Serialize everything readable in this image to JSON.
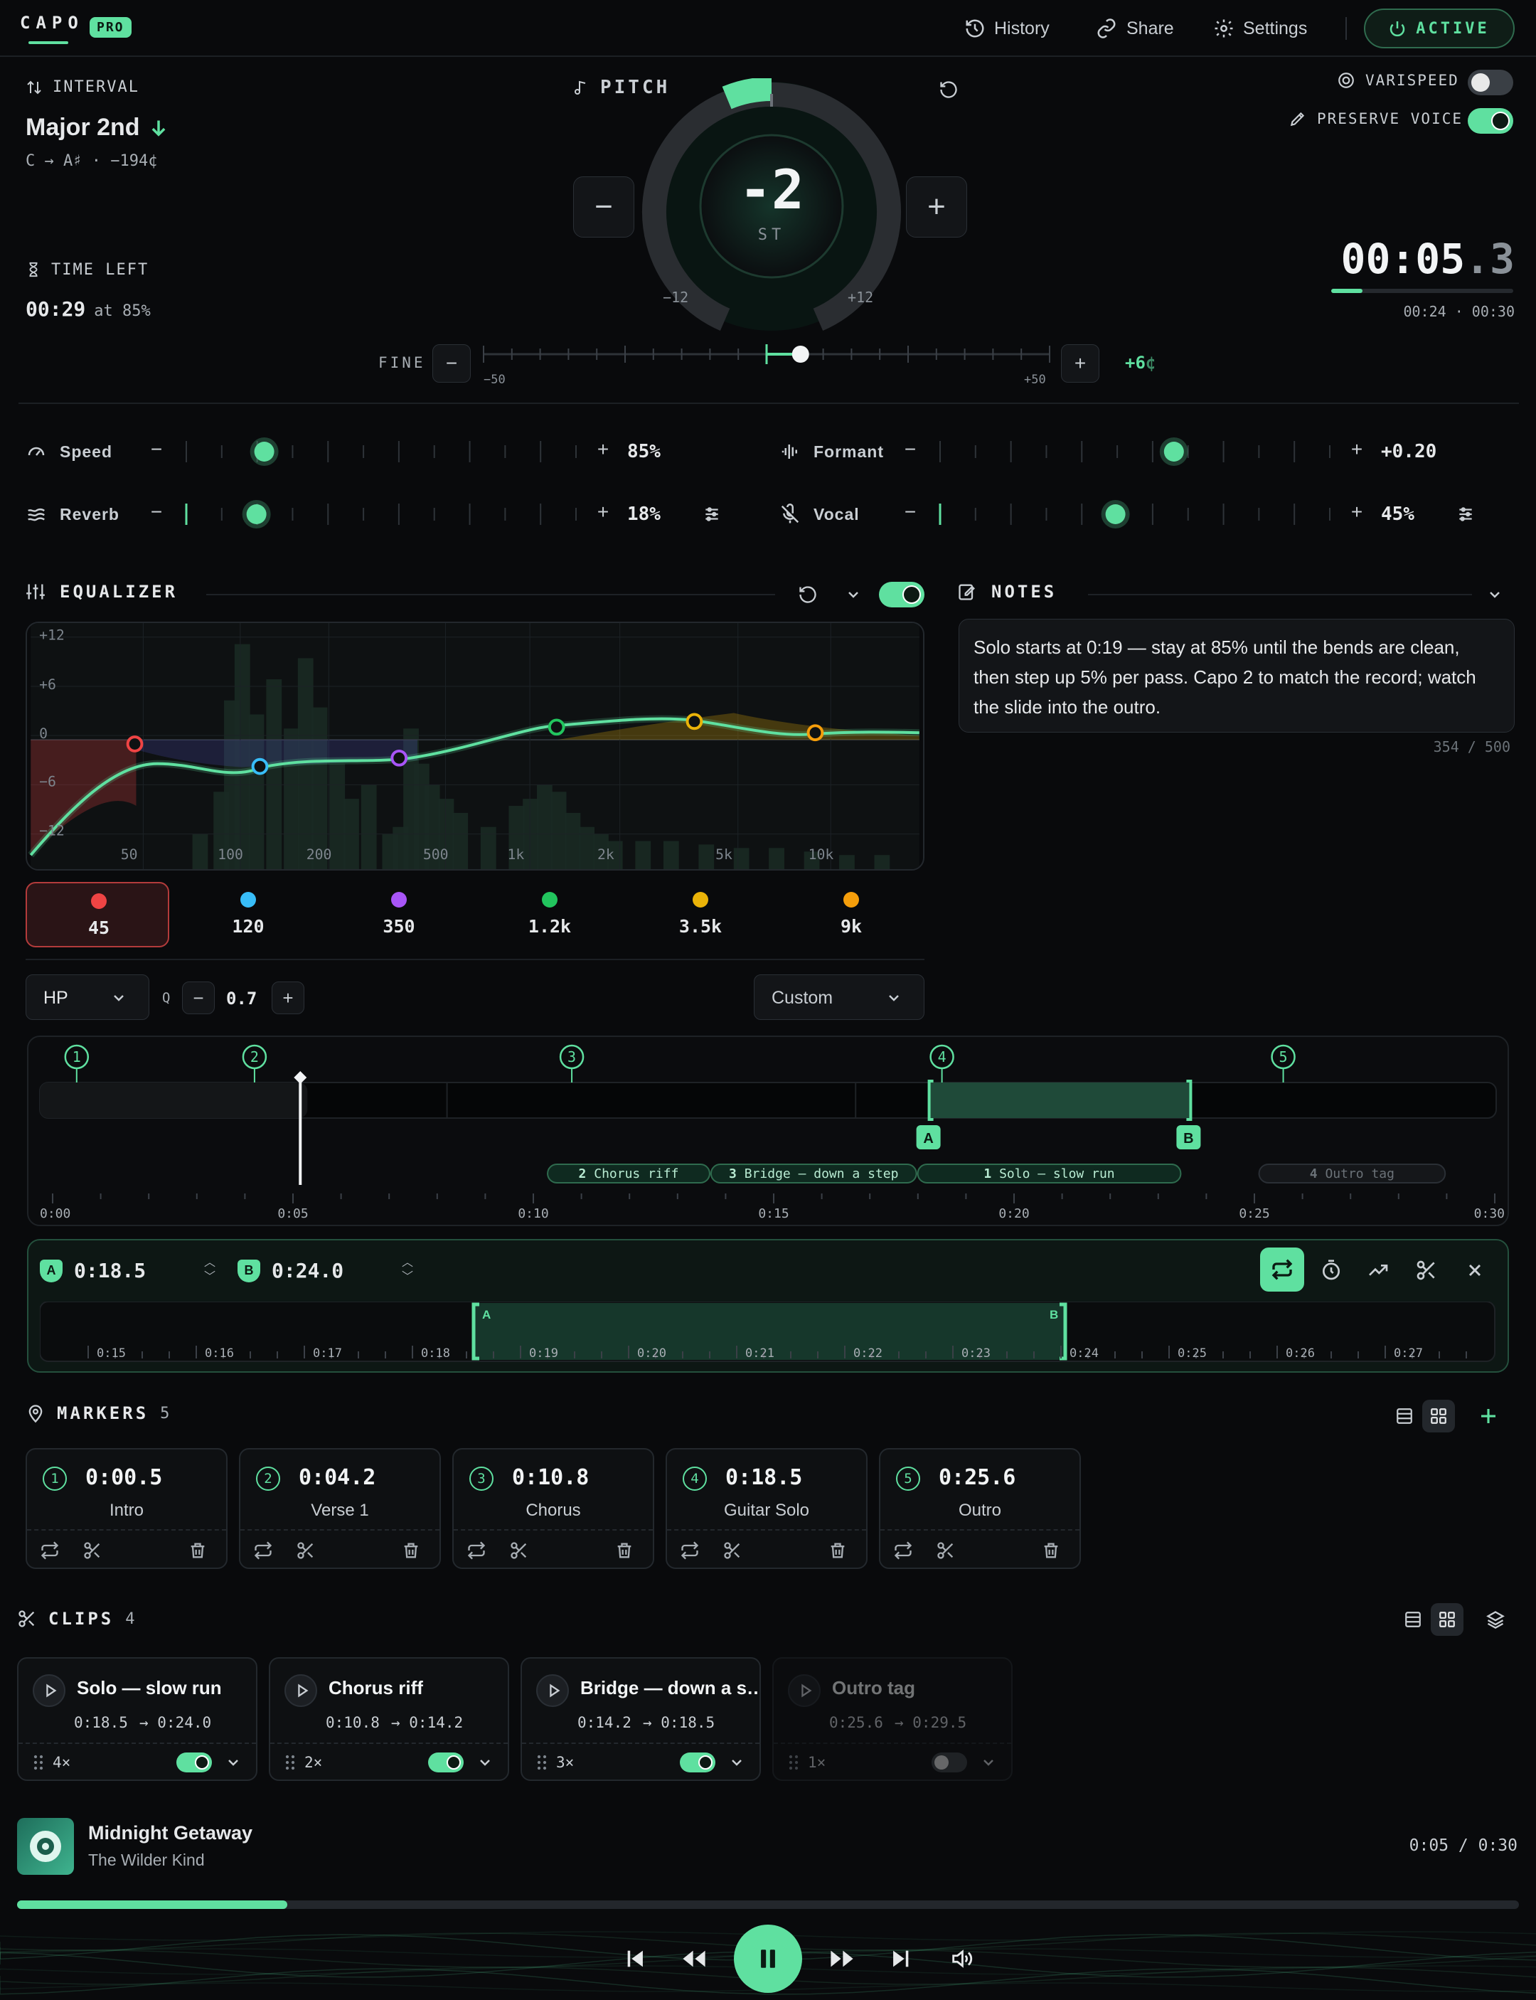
{
  "header": {
    "logo": "CAPO",
    "badge": "PRO",
    "nav": [
      {
        "label": "History"
      },
      {
        "label": "Share"
      },
      {
        "label": "Settings"
      }
    ],
    "status": "ACTIVE"
  },
  "interval": {
    "label": "INTERVAL",
    "name": "Major 2nd",
    "sub": "C → A♯ · −194¢"
  },
  "time_left": {
    "label": "TIME LEFT",
    "value": "00:29",
    "suffix": "at 85%"
  },
  "pitch": {
    "label": "PITCH",
    "value": "-2",
    "unit": "ST",
    "min": "−12",
    "max": "+12",
    "fine_label": "FINE",
    "fine_min": "−50",
    "fine_max": "+50",
    "fine_value": "+6",
    "fine_unit": "¢",
    "dial_fraction": 0.417,
    "fine_fraction": 0.56
  },
  "options": {
    "varispeed": "VARISPEED",
    "varispeed_on": false,
    "preserve": "PRESERVE VOICE",
    "preserve_on": true
  },
  "timer": {
    "main": "00:05",
    "frac": ".3",
    "progress": 0.17,
    "sub": "00:24 · 00:30"
  },
  "sliders": [
    {
      "name": "Speed",
      "value": "85%",
      "fraction": 0.2
    },
    {
      "name": "Formant",
      "value": "+0.20",
      "fraction": 0.6
    },
    {
      "name": "Reverb",
      "value": "18%",
      "fraction": 0.18
    },
    {
      "name": "Vocal",
      "value": "45%",
      "fraction": 0.45
    }
  ],
  "equalizer": {
    "title": "EQUALIZER",
    "on": true,
    "y_ticks": [
      "+12",
      "+6",
      "0",
      "−6",
      "−12"
    ],
    "x_ticks": [
      "50",
      "100",
      "200",
      "500",
      "1k",
      "2k",
      "5k",
      "10k"
    ],
    "bands": [
      {
        "freq": "45",
        "color": "#ef4444"
      },
      {
        "freq": "120",
        "color": "#38bdf8"
      },
      {
        "freq": "350",
        "color": "#a855f7"
      },
      {
        "freq": "1.2k",
        "color": "#22c55e"
      },
      {
        "freq": "3.5k",
        "color": "#eab308"
      },
      {
        "freq": "9k",
        "color": "#f59e0b"
      }
    ],
    "filter": "HP",
    "q_label": "Q",
    "q_value": "0.7",
    "preset": "Custom"
  },
  "notes": {
    "title": "NOTES",
    "text": "Solo starts at 0:19 — stay at 85% until the bends are clean, then step up 5% per pass. Capo 2 to match the record; watch the slide into the outro.",
    "count": "354 / 500"
  },
  "timeline": {
    "markers": [
      "1",
      "2",
      "3",
      "4",
      "5"
    ],
    "ticks": [
      "0:00",
      "0:05",
      "0:10",
      "0:15",
      "0:20",
      "0:25",
      "0:30"
    ],
    "a": "A",
    "b": "B",
    "clips": [
      {
        "n": "2",
        "name": "Chorus riff"
      },
      {
        "n": "3",
        "name": "Bridge — down a step"
      },
      {
        "n": "1",
        "name": "Solo — slow run"
      },
      {
        "n": "4",
        "name": "Outro tag"
      }
    ]
  },
  "loop": {
    "a_label": "A",
    "a_time": "0:18.5",
    "b_label": "B",
    "b_time": "0:24.0",
    "ticks": [
      "0:15",
      "0:16",
      "0:17",
      "0:18",
      "0:19",
      "0:20",
      "0:21",
      "0:22",
      "0:23",
      "0:24",
      "0:25",
      "0:26",
      "0:27"
    ]
  },
  "markers": {
    "title": "MARKERS",
    "count": "5",
    "items": [
      {
        "n": "1",
        "time": "0:00.5",
        "name": "Intro"
      },
      {
        "n": "2",
        "time": "0:04.2",
        "name": "Verse 1"
      },
      {
        "n": "3",
        "time": "0:10.8",
        "name": "Chorus"
      },
      {
        "n": "4",
        "time": "0:18.5",
        "name": "Guitar Solo"
      },
      {
        "n": "5",
        "time": "0:25.6",
        "name": "Outro"
      }
    ]
  },
  "clips": {
    "title": "CLIPS",
    "count": "4",
    "items": [
      {
        "name": "Solo — slow run",
        "start": "0:18.5",
        "end": "→ 0:24.0",
        "rep": "4×",
        "on": true
      },
      {
        "name": "Chorus riff",
        "start": "0:10.8",
        "end": "→ 0:14.2",
        "rep": "2×",
        "on": true
      },
      {
        "name": "Bridge — down a s…",
        "start": "0:14.2",
        "end": "→ 0:18.5",
        "rep": "3×",
        "on": true
      },
      {
        "name": "Outro tag",
        "start": "0:25.6",
        "end": "→ 0:29.5",
        "rep": "1×",
        "on": false
      }
    ]
  },
  "player": {
    "title": "Midnight Getaway",
    "artist": "The Wilder Kind",
    "time": "0:05 / 0:30",
    "progress": 0.18
  }
}
